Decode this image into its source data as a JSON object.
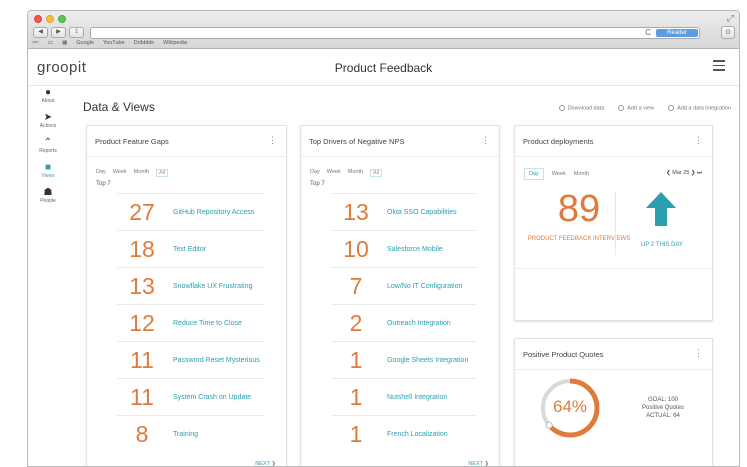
{
  "browser": {
    "nav_back": "◀",
    "nav_forward": "▶",
    "share": "⇪",
    "reload": "C",
    "reader": "Reader",
    "tab_count": "⊙",
    "bookmarks": [
      "Google",
      "YouTube",
      "Dribbble",
      "Wikipedia"
    ]
  },
  "app": {
    "logo": "groopit",
    "page_title": "Product Feedback"
  },
  "sidenav": [
    {
      "icon": "●",
      "label": "About"
    },
    {
      "icon": "➤",
      "label": "Actions"
    },
    {
      "icon": "⌃",
      "label": "Reports"
    },
    {
      "icon": "■",
      "label": "Views"
    },
    {
      "icon": "☗",
      "label": "People"
    }
  ],
  "main": {
    "title": "Data & Views",
    "actions": [
      "Download data",
      "Add a view",
      "Add a data integration"
    ]
  },
  "filters": [
    "Day",
    "Week",
    "Month",
    "All"
  ],
  "cards": {
    "feature_gaps": {
      "title": "Product Feature Gaps",
      "top_label": "Top 7",
      "next": "NEXT ❯",
      "rows": [
        {
          "num": "27",
          "label": "GitHub Repository Access"
        },
        {
          "num": "18",
          "label": "Text Editor"
        },
        {
          "num": "13",
          "label": "Snowflake UX Frustrating"
        },
        {
          "num": "12",
          "label": "Reduce Time to Close"
        },
        {
          "num": "11",
          "label": "Password Reset Mysterious"
        },
        {
          "num": "11",
          "label": "System Crash on Update"
        },
        {
          "num": "8",
          "label": "Training"
        }
      ]
    },
    "negative_nps": {
      "title": "Top Drivers of Negative NPS",
      "top_label": "Top 7",
      "next": "NEXT ❯",
      "rows": [
        {
          "num": "13",
          "label": "Okta SSO Capabilities"
        },
        {
          "num": "10",
          "label": "Salesforce Mobile"
        },
        {
          "num": "7",
          "label": "Low/No IT Configuration"
        },
        {
          "num": "2",
          "label": "Outreach Integration"
        },
        {
          "num": "1",
          "label": "Google Sheets Integration"
        },
        {
          "num": "1",
          "label": "Nutshell Integration"
        },
        {
          "num": "1",
          "label": "French Localization"
        }
      ]
    },
    "deployments": {
      "title": "Product deployments",
      "filters": [
        "Day",
        "Week",
        "Month"
      ],
      "date_nav": "❮ Mar 25 ❯ ⏭",
      "big_number": "89",
      "big_label": "PRODUCT FEEDBACK INTERVIEWS",
      "trend_label": "UP 2 THIS DAY"
    },
    "quotes": {
      "title": "Positive Product Quotes",
      "percent": "64%",
      "percent_value": 0.64,
      "goal_line1": "GOAL: 100",
      "goal_line2": "Positive Quotes",
      "goal_line3": "ACTUAL: 64"
    }
  },
  "colors": {
    "accent": "#2a9fae",
    "orange": "#e07a3b"
  }
}
